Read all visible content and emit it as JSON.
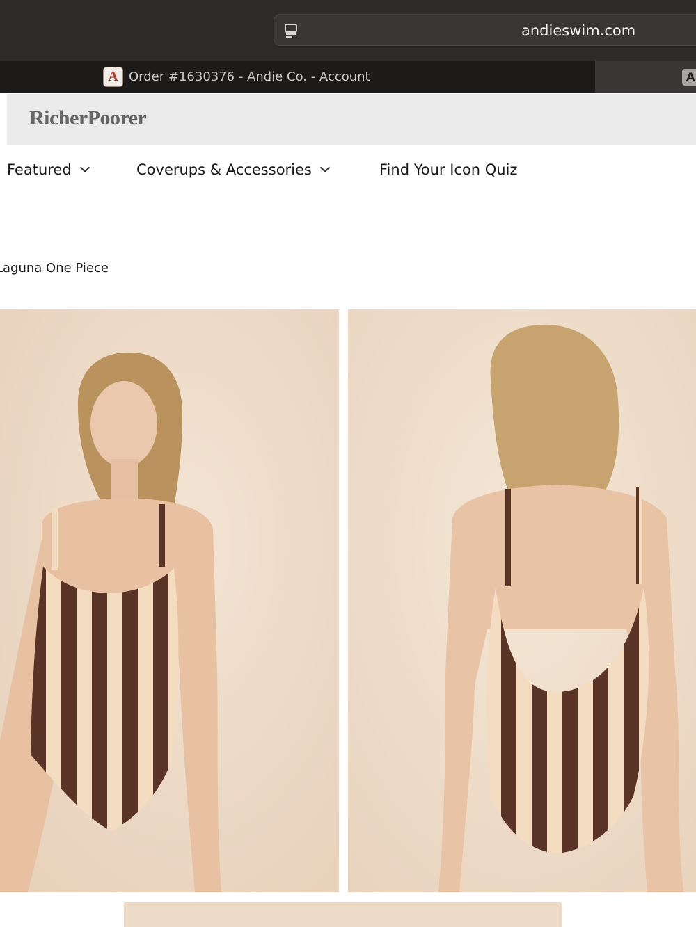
{
  "browser": {
    "url": "andieswim.com",
    "active_tab": {
      "favicon_letter": "A",
      "title": "Order #1630376 - Andie Co. - Account"
    },
    "next_tab_favicon_letter": "A"
  },
  "banner": {
    "brand": "RicherPoorer"
  },
  "nav": {
    "items": [
      {
        "label": "Featured",
        "has_dropdown": true
      },
      {
        "label": "Coverups & Accessories",
        "has_dropdown": true
      },
      {
        "label": "Find Your Icon Quiz",
        "has_dropdown": false
      }
    ]
  },
  "breadcrumb": "Laguna One Piece",
  "product_images": [
    {
      "view": "front"
    },
    {
      "view": "back"
    },
    {
      "view": "partial"
    }
  ],
  "colors": {
    "chrome_dark": "#2e2a29",
    "photo_background": "#eddbc8",
    "stripe_brown": "#5a3426",
    "stripe_cream": "#f3dcc0"
  }
}
